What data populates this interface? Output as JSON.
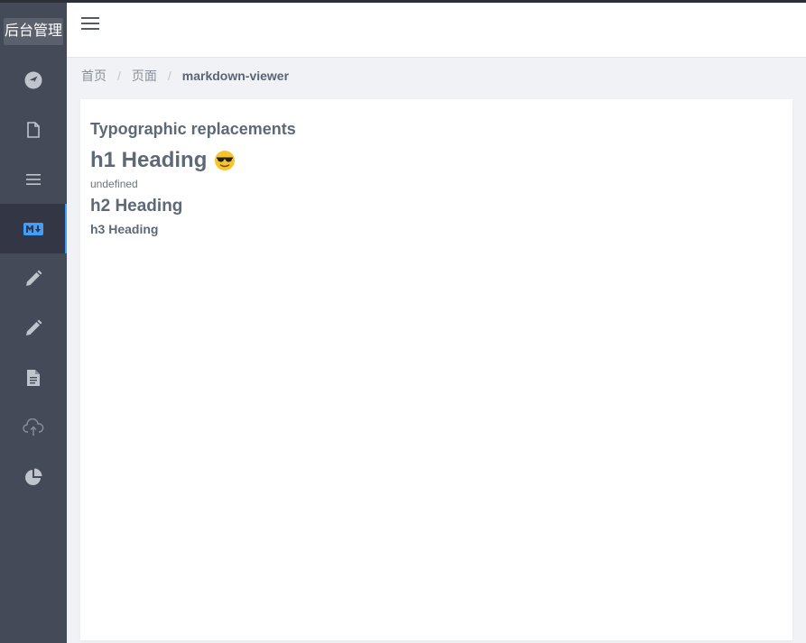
{
  "sidebar": {
    "logo_text": "后台管理",
    "items": [
      {
        "icon": "navigation-icon",
        "active": false
      },
      {
        "icon": "document-icon",
        "active": false
      },
      {
        "icon": "list-icon",
        "active": false
      },
      {
        "icon": "markdown-icon",
        "active": true
      },
      {
        "icon": "pencil-icon",
        "active": false
      },
      {
        "icon": "pencil-icon",
        "active": false
      },
      {
        "icon": "text-document-icon",
        "active": false
      },
      {
        "icon": "cloud-upload-icon",
        "active": false
      },
      {
        "icon": "pie-chart-icon",
        "active": false
      }
    ]
  },
  "header": {
    "menu_icon": "hamburger-menu-icon"
  },
  "breadcrumb": {
    "items": [
      "首页",
      "页面",
      "markdown-viewer"
    ],
    "separator": "/"
  },
  "content": {
    "title": "Typographic replacements",
    "h1": "h1 Heading",
    "h1_emoji": "sunglasses-emoji",
    "undefined_text": "undefined",
    "h2": "h2 Heading",
    "h3": "h3 Heading"
  },
  "colors": {
    "sidebar_bg": "#454a59",
    "active_bg": "#333745",
    "accent": "#409eff",
    "icon": "#c0c4cc",
    "text": "#5e6977"
  }
}
